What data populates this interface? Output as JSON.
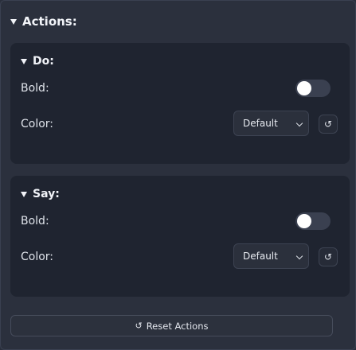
{
  "actions": {
    "title": "Actions:",
    "sections": [
      {
        "title": "Do:",
        "bold_label": "Bold:",
        "bold_enabled": false,
        "color_label": "Color:",
        "color_value": "Default",
        "reset_icon": "↺"
      },
      {
        "title": "Say:",
        "bold_label": "Bold:",
        "bold_enabled": false,
        "color_label": "Color:",
        "color_value": "Default",
        "reset_icon": "↺"
      }
    ],
    "reset_button": {
      "icon": "↺",
      "label": "Reset Actions"
    }
  },
  "icons": {
    "collapse": "caret-down-icon",
    "reset": "reset-icon",
    "select": "chevron-down-icon"
  },
  "colors": {
    "background": "#2b303d",
    "card": "#1f2430",
    "toggle_off": "#3a4050",
    "knob": "#ffffff",
    "text": "#e4e7ee"
  }
}
